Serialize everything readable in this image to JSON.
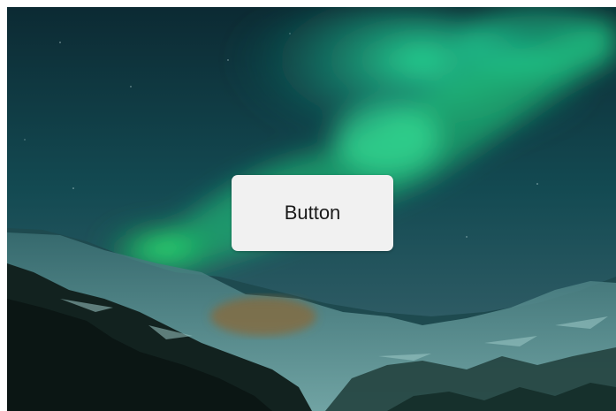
{
  "hero": {
    "background_image": "aurora-borealis-over-snowy-mountains",
    "button_label": "Button"
  },
  "colors": {
    "sky_top": "#0d2c33",
    "sky_mid": "#145a5a",
    "aurora": "#1fe08c",
    "button_bg": "#f1f1f1",
    "button_text": "#1a1a1a"
  }
}
